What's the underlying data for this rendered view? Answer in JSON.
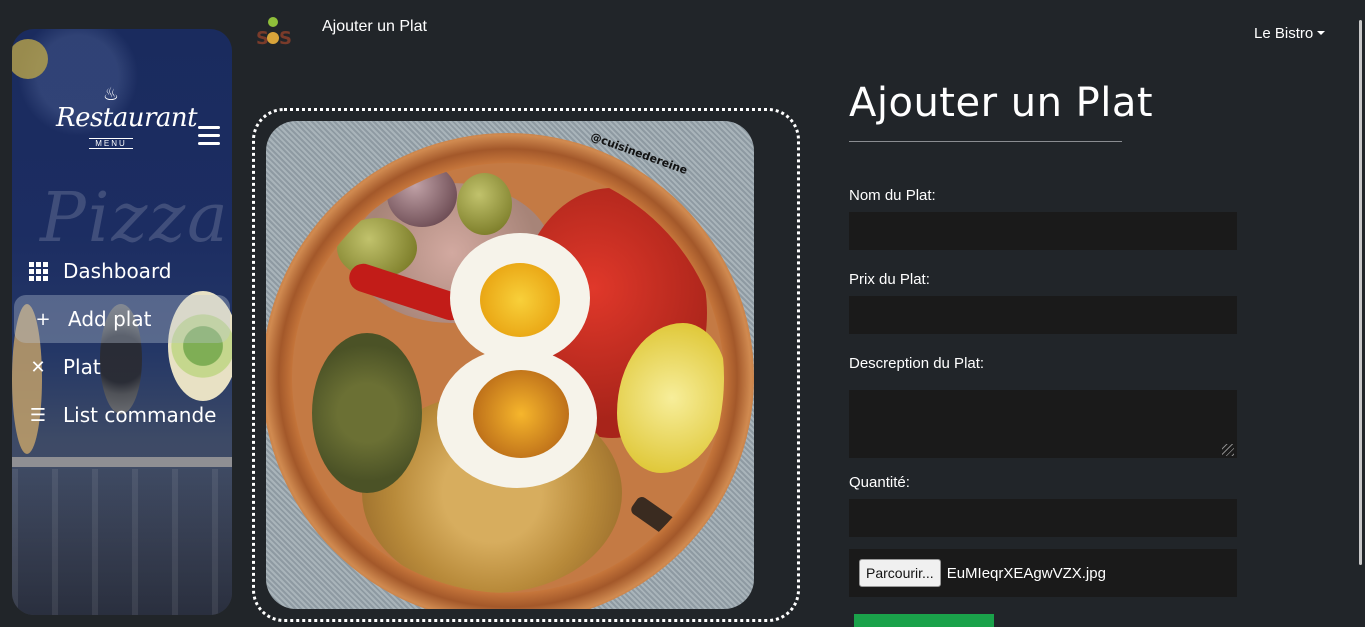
{
  "topbar": {
    "title": "Ajouter un Plat",
    "user_menu": "Le Bistro"
  },
  "sidebar": {
    "logo": {
      "text": "Restaurant",
      "sub": "MENU"
    },
    "background_word": "Pizza",
    "items": [
      {
        "label": "Dashboard",
        "icon": "grid-icon",
        "active": false
      },
      {
        "label": "Add plat",
        "icon": "plus-icon",
        "active": true
      },
      {
        "label": "Plat",
        "icon": "utensils-icon",
        "active": false
      },
      {
        "label": "List commande",
        "icon": "list-icon",
        "active": false
      }
    ]
  },
  "preview": {
    "watermark": "@cuisinedereine"
  },
  "form": {
    "title": "Ajouter un Plat",
    "name_label": "Nom du Plat:",
    "price_label": "Prix du Plat:",
    "description_label": "Descreption du Plat:",
    "quantity_label": "Quantité:",
    "browse_label": "Parcourir...",
    "file_name": "EuMIeqrXEAgwVZX.jpg"
  },
  "colors": {
    "background": "#212529",
    "submit": "#1aa24a",
    "input": "#1a1a1a"
  }
}
